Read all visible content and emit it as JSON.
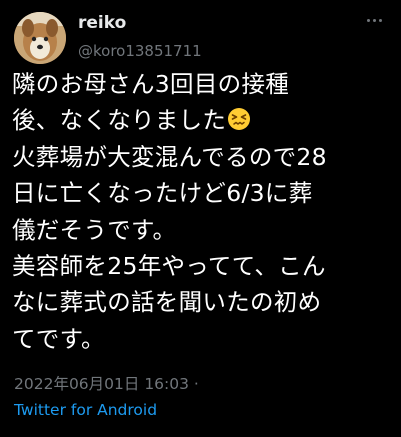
{
  "author": {
    "display_name": "reiko",
    "handle": "@koro13851711"
  },
  "tweet": {
    "lines": [
      "隣のお母さん3回目の接種",
      "後、なくなりました",
      "火葬場が大変混んでるので28",
      "日に亡くなったけど6/3に葬",
      "儀だそうです。",
      "美容師を25年やってて、こん",
      "なに葬式の話を聞いたの初め",
      "てです。"
    ],
    "emoji": "confounded-face"
  },
  "meta": {
    "timestamp": "2022年06月01日 16:03 ·",
    "source": "Twitter for Android"
  },
  "colors": {
    "background": "#000000",
    "text": "#ffffff",
    "muted": "#71767b",
    "link": "#1d9bf0"
  }
}
